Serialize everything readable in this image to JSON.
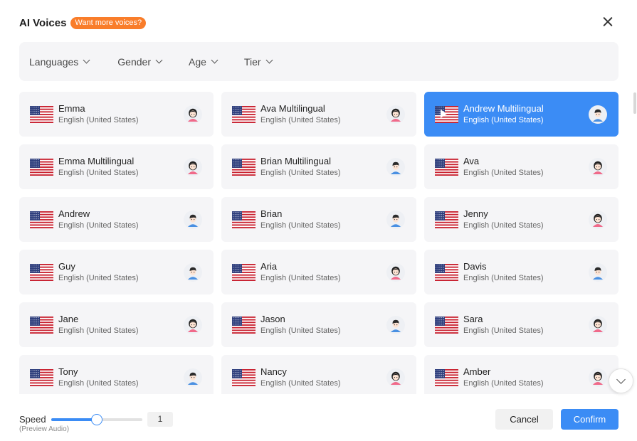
{
  "dialog": {
    "title": "AI Voices",
    "badge": "Want more voices?",
    "close_icon": "close-icon"
  },
  "filters": [
    {
      "label": "Languages"
    },
    {
      "label": "Gender"
    },
    {
      "label": "Age"
    },
    {
      "label": "Tier"
    }
  ],
  "voices": [
    {
      "name": "Emma",
      "lang": "English (United States)",
      "gender": "female",
      "selected": false
    },
    {
      "name": "Ava Multilingual",
      "lang": "English (United States)",
      "gender": "female",
      "selected": false
    },
    {
      "name": "Andrew Multilingual",
      "lang": "English (United States)",
      "gender": "male",
      "selected": true
    },
    {
      "name": "Emma Multilingual",
      "lang": "English (United States)",
      "gender": "female",
      "selected": false
    },
    {
      "name": "Brian Multilingual",
      "lang": "English (United States)",
      "gender": "male",
      "selected": false
    },
    {
      "name": "Ava",
      "lang": "English (United States)",
      "gender": "female",
      "selected": false
    },
    {
      "name": "Andrew",
      "lang": "English (United States)",
      "gender": "male",
      "selected": false
    },
    {
      "name": "Brian",
      "lang": "English (United States)",
      "gender": "male",
      "selected": false
    },
    {
      "name": "Jenny",
      "lang": "English (United States)",
      "gender": "female",
      "selected": false
    },
    {
      "name": "Guy",
      "lang": "English (United States)",
      "gender": "male",
      "selected": false
    },
    {
      "name": "Aria",
      "lang": "English (United States)",
      "gender": "female",
      "selected": false
    },
    {
      "name": "Davis",
      "lang": "English (United States)",
      "gender": "male",
      "selected": false
    },
    {
      "name": "Jane",
      "lang": "English (United States)",
      "gender": "female",
      "selected": false
    },
    {
      "name": "Jason",
      "lang": "English (United States)",
      "gender": "male",
      "selected": false
    },
    {
      "name": "Sara",
      "lang": "English (United States)",
      "gender": "female",
      "selected": false
    },
    {
      "name": "Tony",
      "lang": "English (United States)",
      "gender": "male",
      "selected": false
    },
    {
      "name": "Nancy",
      "lang": "English (United States)",
      "gender": "female",
      "selected": false
    },
    {
      "name": "Amber",
      "lang": "English (United States)",
      "gender": "female",
      "selected": false
    }
  ],
  "speed": {
    "label": "Speed",
    "sublabel": "(Preview Audio)",
    "value": "1",
    "slider_fraction": 0.5
  },
  "buttons": {
    "cancel": "Cancel",
    "confirm": "Confirm"
  },
  "colors": {
    "accent": "#3b8cf5",
    "badge": "#f97d2a",
    "card_bg": "#f5f5f7"
  }
}
